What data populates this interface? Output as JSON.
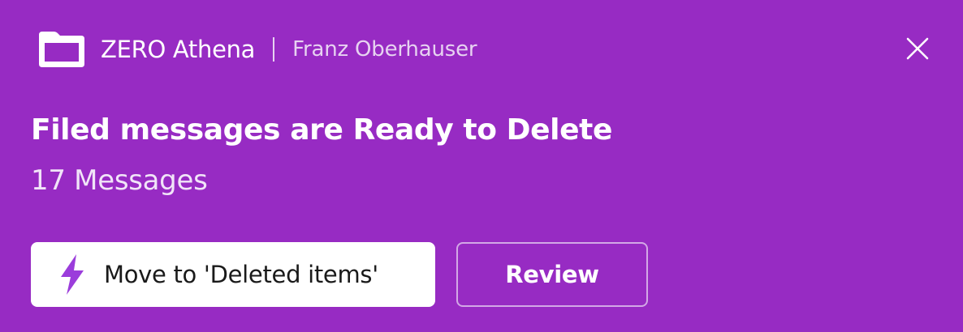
{
  "header": {
    "app_name": "ZERO Athena",
    "user_name": "Franz Oberhauser",
    "app_icon": "folder-icon",
    "close_icon": "close-icon"
  },
  "notification": {
    "title": "Filed messages are Ready to Delete",
    "subtitle": "17 Messages"
  },
  "actions": {
    "primary_label": "Move to 'Deleted items'",
    "primary_icon": "lightning-bolt-icon",
    "secondary_label": "Review"
  },
  "colors": {
    "background": "#972BC3",
    "primary_button_bg": "#FFFFFF",
    "bolt_icon": "#9B3DDB",
    "text": "#FFFFFF"
  }
}
